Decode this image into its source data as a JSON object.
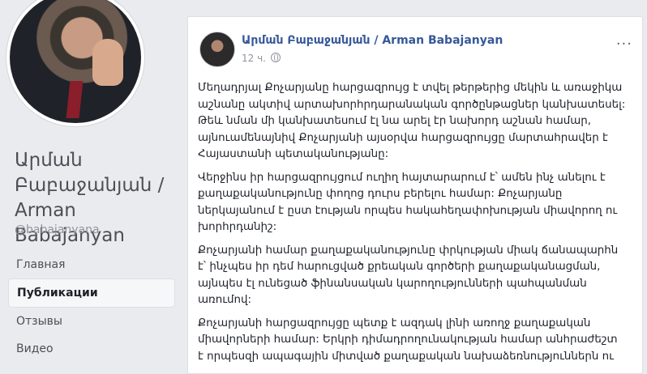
{
  "profile": {
    "name": "Արման Բաբաջանյան / Arman Babajanyan",
    "handle": "@babajanyana"
  },
  "nav": {
    "items": [
      {
        "label": "Главная"
      },
      {
        "label": "Публикации"
      },
      {
        "label": "Отзывы"
      },
      {
        "label": "Видео"
      }
    ]
  },
  "post": {
    "author": "Արման Բաբաջանյան / Arman Babajanyan",
    "time": "12 ч.",
    "more": "...",
    "paragraphs": [
      "Մեղադրյալ Քոչարյանը հարցազրույց է տվել թերթերից մեկին և առաջիկա աշնանը ակտիվ արտախորհրդարանական գործընթացներ կանխատեսել: Թեև նման մի կանխատեսում էլ նա արել էր նախորդ աշնան համար, այնուամենայնիվ Քոչարյանի այսօրվա հարցազրույցը մարտահրավեր է Հայաստանի պետականությանը:",
      "Վերջինս իր հարցազրույցում ուղիղ հայտարարում է՝ ամեն ինչ անելու է քաղաքականությունը փողոց դուրս բերելու համար: Քոչարյանը ներկայանում է ըստ էության որպես հակահեղափոխության միավորող ու խորհրդանիշ:",
      "Քոչարյանի համար քաղաքականությունը փրկության միակ ճանապարհն է՝ ինչպես իր դեմ հարուցված քրեական գործերի քաղաքականացման, այնպես էլ ունեցած ֆինանսական կարողությունների պահպանման առումով:",
      "Քոչարյանի հարցազրույցը պետք է ազդակ լինի առողջ քաղաքական միավորների համար: Երկրի դիմադրողունակության համար անհրաժեշտ է որպեսզի ապագային միտված քաղաքական նախաձեռնություններն ու"
    ]
  }
}
